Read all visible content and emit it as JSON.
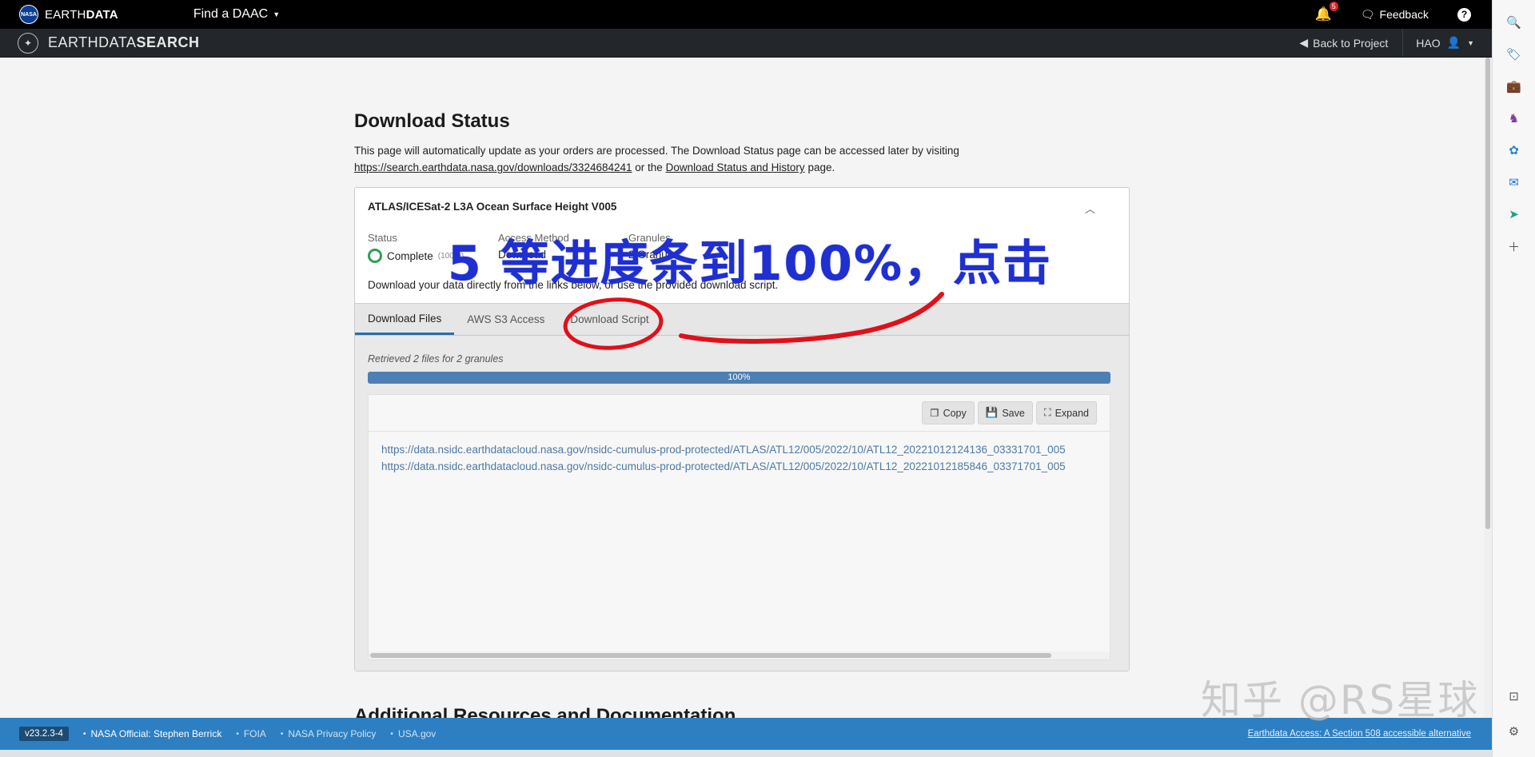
{
  "topbar": {
    "logo_text": "NASA",
    "brand_light": "EARTH",
    "brand_bold": "DATA",
    "daac_label": "Find a DAAC",
    "notification_count": "5",
    "feedback_label": "Feedback",
    "help_label": "?"
  },
  "appbar": {
    "title_light": "EARTHDATA",
    "title_bold": "SEARCH",
    "back_label": "Back to Project",
    "user_label": "HAO"
  },
  "page": {
    "title": "Download Status",
    "intro_text": "This page will automatically update as your orders are processed. The Download Status page can be accessed later by visiting",
    "download_link": "https://search.earthdata.nasa.gov/downloads/3324684241",
    "or_the": "or the",
    "history_link": "Download Status and History",
    "page_word": "page.",
    "next_heading": "Additional Resources and Documentation"
  },
  "order": {
    "title": "ATLAS/ICESat-2 L3A Ocean Surface Height V005",
    "status_label": "Status",
    "status_value": "Complete",
    "status_pct": "(100%)",
    "access_label": "Access Method",
    "access_value": "Download",
    "granules_label": "Granules",
    "granules_value": "2 Granules",
    "description": "Download your data directly from the links below, or use the provided download script.",
    "tabs": [
      {
        "label": "Download Files",
        "active": true
      },
      {
        "label": "AWS S3 Access",
        "active": false
      },
      {
        "label": "Download Script",
        "active": false
      }
    ],
    "retrieved_text": "Retrieved 2 files for 2 granules",
    "progress_label": "100%",
    "progress_fraction": 1.0,
    "buttons": {
      "copy": "Copy",
      "save": "Save",
      "expand": "Expand"
    },
    "links": [
      "https://data.nsidc.earthdatacloud.nasa.gov/nsidc-cumulus-prod-protected/ATLAS/ATL12/005/2022/10/ATL12_20221012124136_03331701_005",
      "https://data.nsidc.earthdatacloud.nasa.gov/nsidc-cumulus-prod-protected/ATLAS/ATL12/005/2022/10/ATL12_20221012185846_03371701_005"
    ]
  },
  "footer": {
    "version": "v23.2.3-4",
    "official": "NASA Official: Stephen Berrick",
    "foia": "FOIA",
    "privacy": "NASA Privacy Policy",
    "usagov": "USA.gov",
    "accessible": "Earthdata Access: A Section 508 accessible alternative"
  },
  "annotation": {
    "text": "5 等进度条到100%，点击",
    "color": "#1f2fd0",
    "circle_color": "#e0101a"
  },
  "watermark": "知乎 @RS星球",
  "colors": {
    "topbar": "#000000",
    "appbar": "#23272b",
    "footer": "#2d7fc2",
    "progress": "#4d7fb4",
    "link": "#4d79a8",
    "complete": "#2e9e56"
  }
}
